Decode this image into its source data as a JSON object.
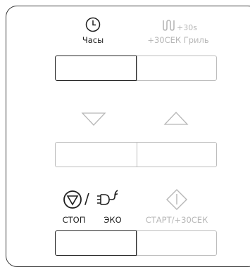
{
  "row1": {
    "clock_label": "Часы",
    "grill_plus_label": "+30s",
    "grill_label": "+30СЕК Гриль"
  },
  "row3": {
    "stop_label": "СТОП",
    "eco_label": "ЭКО",
    "start_label": "СТАРТ/+30СЕК",
    "slash": "/"
  },
  "colors": {
    "active": "#1f1f1f",
    "inactive": "#b7b7b7",
    "border": "#bdbdbd"
  }
}
